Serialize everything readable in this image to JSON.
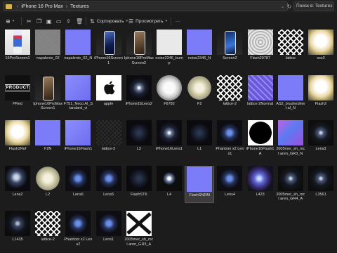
{
  "breadcrumb": {
    "segments": [
      "iPhone 16 Pro Max",
      "Textures"
    ]
  },
  "search": {
    "placeholder": "Поиск в: Textures"
  },
  "toolbar": {
    "sort_label": "Сортировать",
    "view_label": "Просмотреть",
    "more_label": "···"
  },
  "files": [
    {
      "name": "16ProScreen1",
      "thumb": "screenshot"
    },
    {
      "name": "napalenie_02",
      "thumb": "noise"
    },
    {
      "name": "napalenie_02_N",
      "thumb": "normal"
    },
    {
      "name": "iPhone16Screen1",
      "thumb": "phone2"
    },
    {
      "name": "Iphone16ProMax Screen2",
      "thumb": "phone4"
    },
    {
      "name": "noise2346_bump",
      "thumb": "white"
    },
    {
      "name": "noise2346_N",
      "thumb": "normal"
    },
    {
      "name": "Screen2",
      "thumb": "phone5"
    },
    {
      "name": "Flash29787",
      "thumb": "ring"
    },
    {
      "name": "lattice",
      "thumb": "lattice"
    },
    {
      "name": "sss3",
      "thumb": "flash"
    },
    {
      "name": "PRed",
      "thumb": "product"
    },
    {
      "name": "Iphone16ProMax Screen1",
      "thumb": "phone4"
    },
    {
      "name": "F751_Neco Al_Standard_vi",
      "thumb": "normal2"
    },
    {
      "name": "apple",
      "thumb": "apple"
    },
    {
      "name": "iPhone16Lens2",
      "thumb": "lens"
    },
    {
      "name": "F6782",
      "thumb": "dish"
    },
    {
      "name": "F2",
      "thumb": "dish2"
    },
    {
      "name": "lattice-2",
      "thumb": "lattice"
    },
    {
      "name": "lattice-2Normal",
      "thumb": "lattice-n"
    },
    {
      "name": "AS2_brushedmet al_N",
      "thumb": "normal"
    },
    {
      "name": "Flash2",
      "thumb": "flash"
    },
    {
      "name": "Flash2Ref",
      "thumb": "flash"
    },
    {
      "name": "F2N",
      "thumb": "normal"
    },
    {
      "name": "iPhone16Flash1",
      "thumb": "normal2"
    },
    {
      "name": "lattice-3",
      "thumb": "lattice-dark"
    },
    {
      "name": "L3",
      "thumb": "lens2"
    },
    {
      "name": "iPhone16Lens1",
      "thumb": "lens"
    },
    {
      "name": "L1",
      "thumb": "lens2"
    },
    {
      "name": "Phantom x2 Lens1",
      "thumb": "lensblue"
    },
    {
      "name": "iPhone16Flash1A",
      "thumb": "blackdisc"
    },
    {
      "name": "2005mer_sh_mcl aren_GR3_N",
      "thumb": "purple"
    },
    {
      "name": "Lens3",
      "thumb": "lens3"
    },
    {
      "name": "Lens2",
      "thumb": "lens-orb"
    },
    {
      "name": "L2",
      "thumb": "dish2"
    },
    {
      "name": "Lens6",
      "thumb": "lensblue"
    },
    {
      "name": "Lens5",
      "thumb": "lensblue"
    },
    {
      "name": "FlashST6",
      "thumb": "lens2"
    },
    {
      "name": "L4",
      "thumb": "lens-box"
    },
    {
      "name": "FlashSNRM",
      "thumb": "normal",
      "selected": true
    },
    {
      "name": "Lens4",
      "thumb": "lensblue"
    },
    {
      "name": "L423",
      "thumb": "iridescent"
    },
    {
      "name": "2005mer_sh_mcl aren_GR4_A",
      "thumb": "lens3"
    },
    {
      "name": "L3561",
      "thumb": "lens3"
    },
    {
      "name": "L1435",
      "thumb": "l1435"
    },
    {
      "name": "lattice-2",
      "thumb": "lattice"
    },
    {
      "name": "Phantom x2 Lens2",
      "thumb": "lensblue"
    },
    {
      "name": "Lens1",
      "thumb": "lensblue"
    },
    {
      "name": "2005mer_sh_mcl aren_GR3_A",
      "thumb": "crossbig"
    }
  ]
}
